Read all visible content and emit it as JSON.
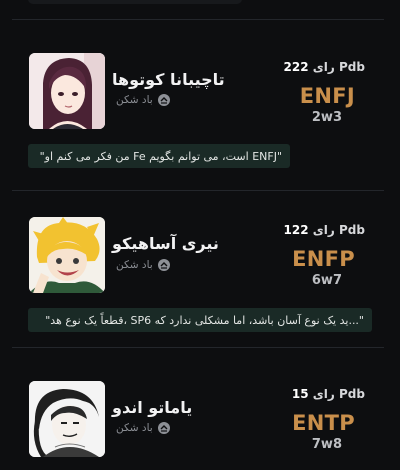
{
  "profiles": [
    {
      "name": "تاچیبانا کوتوها",
      "subtitle": "باد شکن",
      "votes_number": "222",
      "votes_word": "رای",
      "votes_source": "Pdb",
      "mbti": "ENFJ",
      "enneagram": "2w3",
      "quote": "\"ENFJ است، می توانم بگویم Fe من فکر می کنم او\""
    },
    {
      "name": "نیری آساهیکو",
      "subtitle": "باد شکن",
      "votes_number": "122",
      "votes_word": "رای",
      "votes_source": "Pdb",
      "mbti": "ENFP",
      "enneagram": "6w7",
      "quote": "\"...ید یک نوع آسان باشد، اما مشکلی ندارد که SP6 ،قطعاً یک نوع هد\""
    },
    {
      "name": "یاماتو اندو",
      "subtitle": "باد شکن",
      "votes_number": "15",
      "votes_word": "رای",
      "votes_source": "Pdb",
      "mbti": "ENTP",
      "enneagram": "7w8"
    }
  ],
  "colors": {
    "background": "#0d0e10",
    "accent_type": "#c98f4b",
    "quote_background": "#1a2a26",
    "divider": "#23262b"
  }
}
